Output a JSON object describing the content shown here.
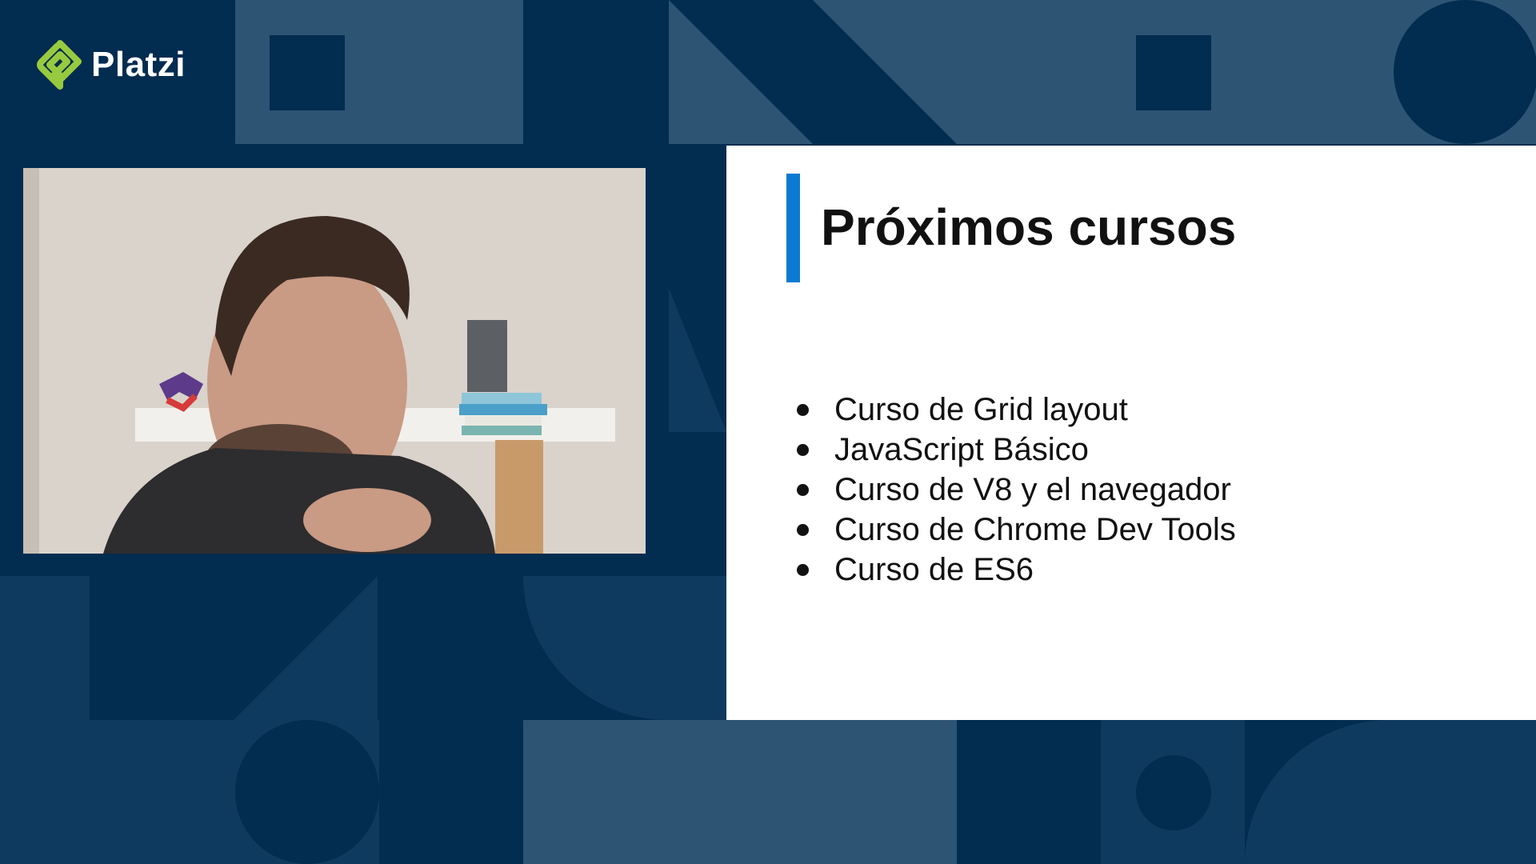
{
  "brand": {
    "name": "Platzi",
    "logo_color": "#98ca3f"
  },
  "slide": {
    "title": "Próximos cursos",
    "accent_color": "#0a7bd1",
    "courses": [
      "Curso de Grid layout",
      "JavaScript Básico",
      "Curso de V8 y el navegador",
      "Curso de Chrome Dev Tools",
      "Curso de ES6"
    ]
  },
  "video": {
    "subject": "instructor-webcam"
  },
  "colors": {
    "background": "#022c50",
    "tile_light": "#2e5474",
    "tile_mid": "#0e3a60"
  }
}
